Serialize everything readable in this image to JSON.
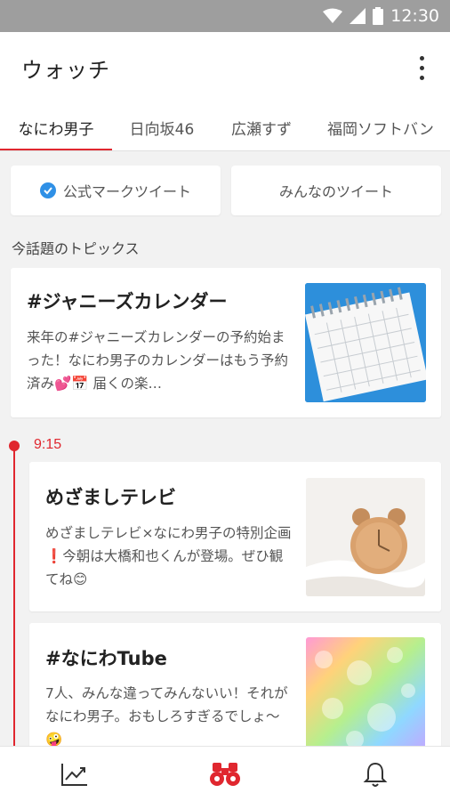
{
  "status_bar": {
    "time": "12:30"
  },
  "app_bar": {
    "title": "ウォッチ"
  },
  "tabs": [
    {
      "label": "なにわ男子",
      "active": true
    },
    {
      "label": "日向坂46",
      "active": false
    },
    {
      "label": "広瀬すず",
      "active": false
    },
    {
      "label": "福岡ソフトバン",
      "active": false
    }
  ],
  "filters": {
    "official": "公式マークツイート",
    "everyone": "みんなのツイート"
  },
  "section_title": "今話題のトピックス",
  "topic_card": {
    "title": "#ジャニーズカレンダー",
    "body": "来年の#ジャニーズカレンダーの予約始まった！なにわ男子のカレンダーはもう予約済み💕📅 届くの楽…"
  },
  "timeline": {
    "time": "9:15",
    "items": [
      {
        "title": "めざましテレビ",
        "body": "めざましテレビ×なにわ男子の特別企画❗今朝は大橋和也くんが登場。ぜひ観てね😊"
      },
      {
        "title": "#なにわTube",
        "body": "7人、みんな違ってみんないい！それがなにわ男子。おもしろすぎるでしょ〜🤪"
      }
    ]
  },
  "bottom_nav": [
    "trending-icon",
    "binoculars-icon",
    "bell-icon"
  ],
  "colors": {
    "accent": "#e0272f",
    "verified": "#2f90e6",
    "status_bar": "#9e9e9e"
  }
}
